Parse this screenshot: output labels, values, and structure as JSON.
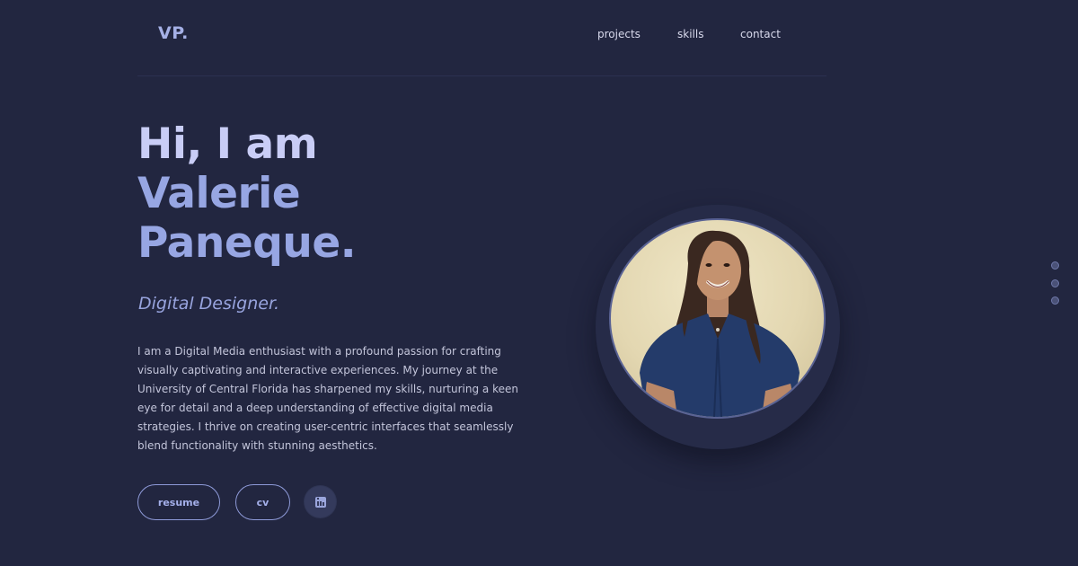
{
  "header": {
    "logo": "VP.",
    "nav": [
      {
        "label": "projects"
      },
      {
        "label": "skills"
      },
      {
        "label": "contact"
      }
    ]
  },
  "hero": {
    "greeting": "Hi, I am",
    "name_line_1": "Valerie",
    "name_line_2": "Paneque.",
    "role": "Digital Designer.",
    "bio": "I am a Digital Media enthusiast with a profound passion for crafting visually captivating and interactive experiences. My journey at the University of Central Florida has sharpened my skills, nurturing a keen eye for detail and a deep understanding of effective digital media strategies. I thrive on creating user-centric interfaces that seamlessly blend functionality with stunning aesthetics."
  },
  "actions": {
    "resume_label": "resume",
    "cv_label": "cv",
    "linkedin_icon": "linkedin-icon"
  },
  "portrait": {
    "subject": "profile-photo"
  },
  "side_nav": {
    "dots": 3
  },
  "colors": {
    "background": "#222640",
    "accent": "#97a6e3",
    "greeting": "#c9cdf6",
    "text": "#c3c5da",
    "border": "#8e9ad8"
  }
}
